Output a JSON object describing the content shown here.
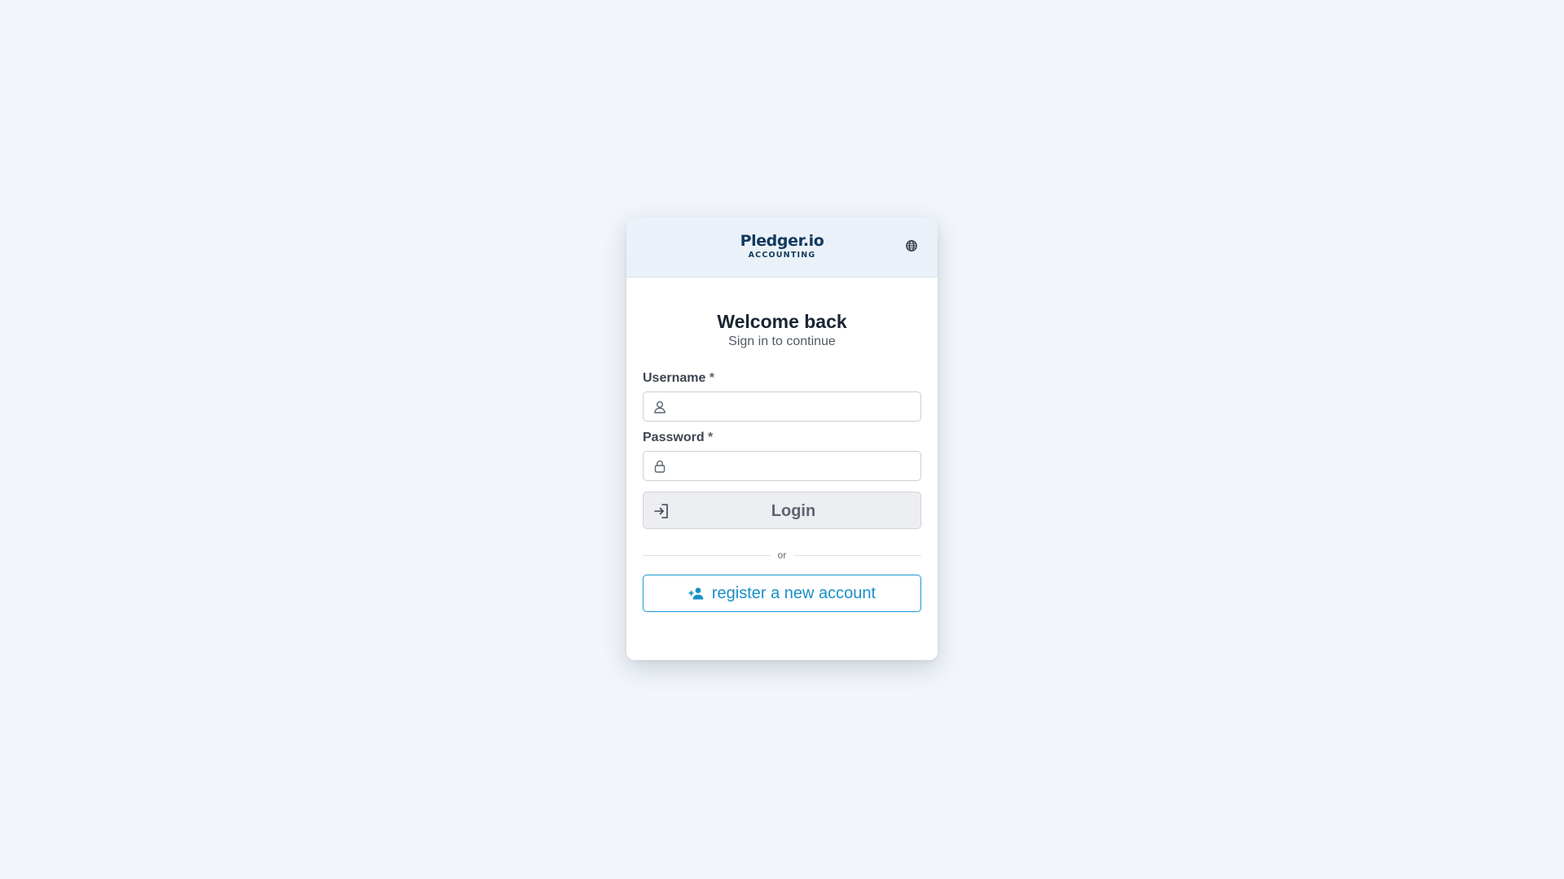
{
  "brand": {
    "name": "Pledger.io",
    "tagline": "ACCOUNTING"
  },
  "header": {
    "language_icon": "globe-icon"
  },
  "form": {
    "title": "Welcome back",
    "subtitle": "Sign in to continue",
    "username": {
      "label": "Username",
      "required_mark": "*",
      "value": "",
      "icon": "user-icon"
    },
    "password": {
      "label": "Password",
      "required_mark": "*",
      "value": "",
      "icon": "lock-icon"
    },
    "login_button": {
      "label": "Login",
      "icon": "login-icon"
    },
    "divider_text": "or",
    "register_button": {
      "label": "register a new account",
      "icon": "user-plus-icon"
    }
  },
  "colors": {
    "page_background": "#f2f6fa",
    "header_background": "#eaf1f8",
    "brand": "#123a5f",
    "accent": "#1a8fc7",
    "login_button_bg": "#eceef1"
  }
}
